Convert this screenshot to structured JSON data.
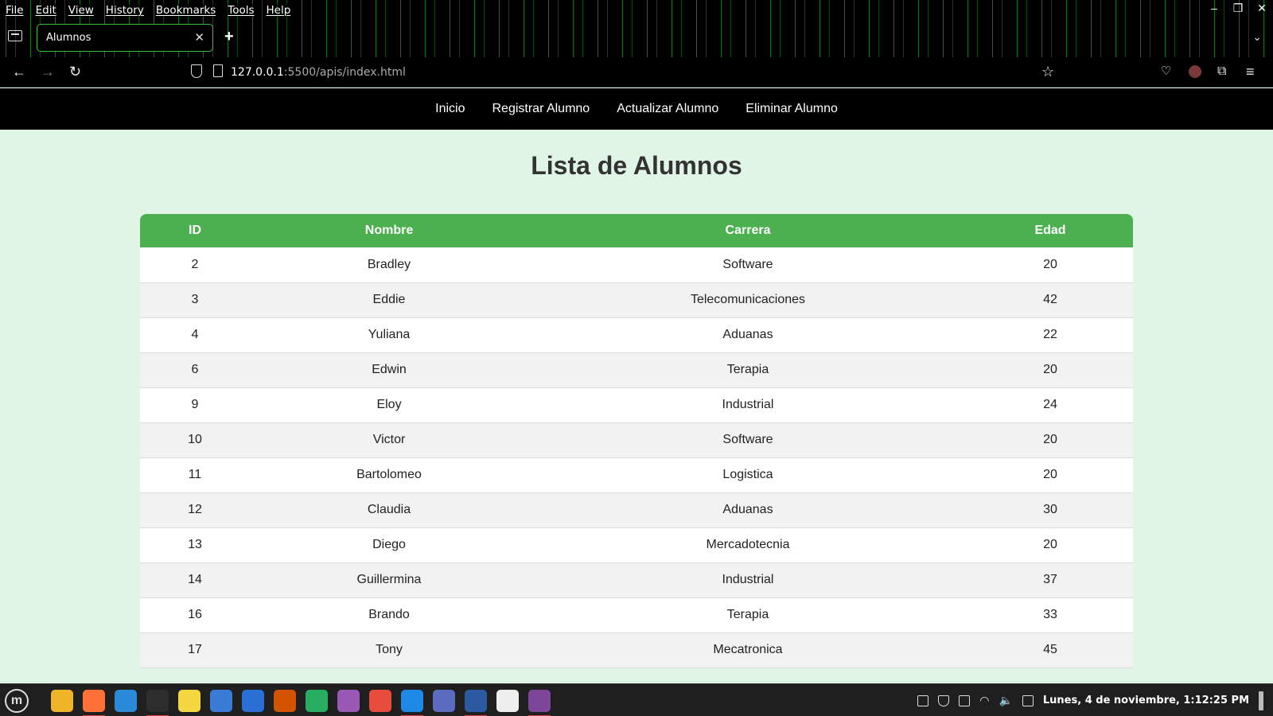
{
  "browser": {
    "menu": [
      "File",
      "Edit",
      "View",
      "History",
      "Bookmarks",
      "Tools",
      "Help"
    ],
    "tab_title": "Alumnos",
    "url_host": "127.0.0.1",
    "url_rest": ":5500/apis/index.html"
  },
  "site": {
    "nav": [
      "Inicio",
      "Registrar Alumno",
      "Actualizar Alumno",
      "Eliminar Alumno"
    ],
    "heading": "Lista de Alumnos",
    "table": {
      "headers": [
        "ID",
        "Nombre",
        "Carrera",
        "Edad"
      ],
      "rows": [
        [
          "2",
          "Bradley",
          "Software",
          "20"
        ],
        [
          "3",
          "Eddie",
          "Telecomunicaciones",
          "42"
        ],
        [
          "4",
          "Yuliana",
          "Aduanas",
          "22"
        ],
        [
          "6",
          "Edwin",
          "Terapia",
          "20"
        ],
        [
          "9",
          "Eloy",
          "Industrial",
          "24"
        ],
        [
          "10",
          "Victor",
          "Software",
          "20"
        ],
        [
          "11",
          "Bartolomeo",
          "Logistica",
          "20"
        ],
        [
          "12",
          "Claudia",
          "Aduanas",
          "30"
        ],
        [
          "13",
          "Diego",
          "Mercadotecnia",
          "20"
        ],
        [
          "14",
          "Guillermina",
          "Industrial",
          "37"
        ],
        [
          "16",
          "Brando",
          "Terapia",
          "33"
        ],
        [
          "17",
          "Tony",
          "Mecatronica",
          "45"
        ]
      ]
    }
  },
  "taskbar": {
    "clock": "Lunes, 4 de noviembre, 1:12:25 PM",
    "apps": [
      {
        "name": "files-icon",
        "color": "#f0b429"
      },
      {
        "name": "firefox-icon",
        "color": "#ff7139"
      },
      {
        "name": "edge-icon",
        "color": "#2b8ad9"
      },
      {
        "name": "terminal-icon",
        "color": "#2d2d2d"
      },
      {
        "name": "notes-icon",
        "color": "#f5d742"
      },
      {
        "name": "screenshot-icon",
        "color": "#3a7bd5"
      },
      {
        "name": "writer-icon",
        "color": "#2a6fd6"
      },
      {
        "name": "impress-icon",
        "color": "#d35400"
      },
      {
        "name": "calc-icon",
        "color": "#27ae60"
      },
      {
        "name": "database-icon",
        "color": "#9b59b6"
      },
      {
        "name": "viewer-icon",
        "color": "#e74c3c"
      },
      {
        "name": "vscode-icon",
        "color": "#1e88e5"
      },
      {
        "name": "teams-icon",
        "color": "#5b6bc0"
      },
      {
        "name": "workbench-icon",
        "color": "#2c5aa0"
      },
      {
        "name": "settings-icon",
        "color": "#eeeeee"
      },
      {
        "name": "tor-icon",
        "color": "#7d4698"
      }
    ]
  }
}
